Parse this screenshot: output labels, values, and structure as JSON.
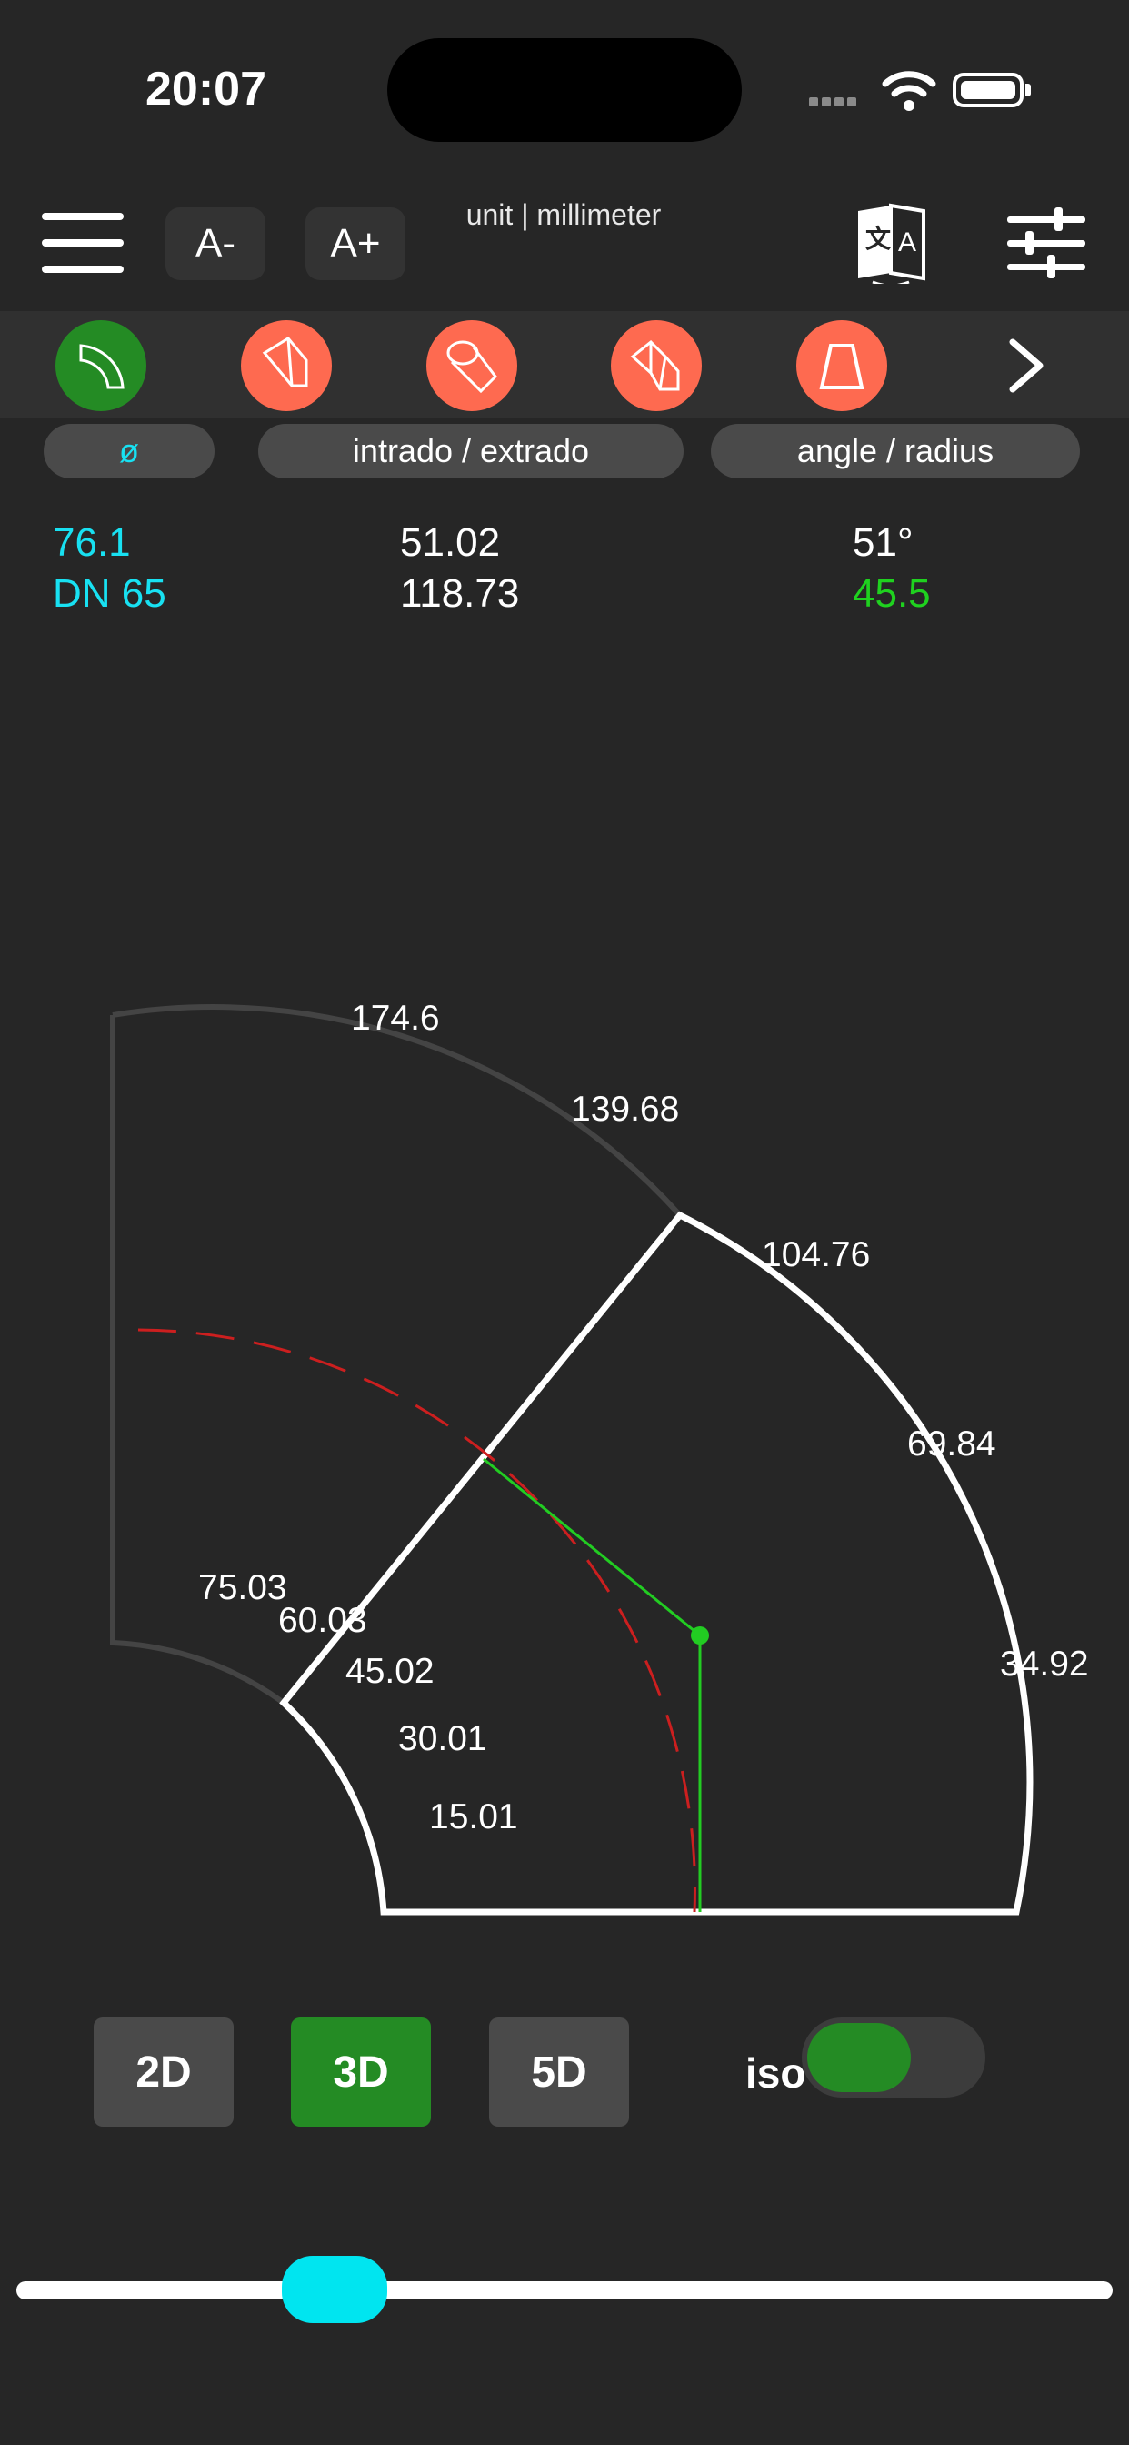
{
  "status_bar": {
    "time": "20:07"
  },
  "header": {
    "font_decrease_label": "A-",
    "font_increase_label": "A+",
    "unit_label": "unit | millimeter"
  },
  "toolbar": {
    "tools": [
      {
        "name": "bend-quarter-tool",
        "active": true
      },
      {
        "name": "bend-segment-tool",
        "active": false
      },
      {
        "name": "bend-pipe-tool",
        "active": false
      },
      {
        "name": "bend-segmented-tool",
        "active": false
      },
      {
        "name": "reducer-tool",
        "active": false
      }
    ]
  },
  "columns": {
    "diameter_label": "ø",
    "intrado_label": "intrado / extrado",
    "angle_label": "angle / radius"
  },
  "values": {
    "diameter": "76.1",
    "dn": "DN 65",
    "intrado": "51.02",
    "extrado": "118.73",
    "angle": "51°",
    "radius": "45.5"
  },
  "diagram": {
    "outer_labels": [
      "174.6",
      "139.68",
      "104.76",
      "69.84",
      "34.92"
    ],
    "inner_labels": [
      "75.03",
      "60.03",
      "45.02",
      "30.01",
      "15.01"
    ],
    "colors": {
      "outline_active": "#ffffff",
      "outline_ghost": "#444444",
      "centerline": "#cc1f1f",
      "radius_line": "#22cc22"
    }
  },
  "bottom": {
    "btn_2d": "2D",
    "btn_3d": "3D",
    "btn_5d": "5D",
    "iso_label": "iso",
    "iso_on": true,
    "active_mode": "3D",
    "slider_value": 0.17
  },
  "colors": {
    "accent_cyan": "#18e1f2",
    "accent_green": "#1fd11f",
    "active_green": "#248b24",
    "tool_orange": "#fe6a50"
  }
}
